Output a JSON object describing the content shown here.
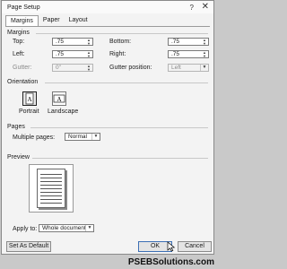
{
  "window": {
    "title": "Page Setup",
    "help_glyph": "?",
    "close_glyph": "✕"
  },
  "tabs": [
    {
      "label": "Margins",
      "active": true
    },
    {
      "label": "Paper",
      "active": false
    },
    {
      "label": "Layout",
      "active": false
    }
  ],
  "margins": {
    "heading": "Margins",
    "top_label": "Top:",
    "top_value": ".75",
    "bottom_label": "Bottom:",
    "bottom_value": ".75",
    "left_label": "Left:",
    "left_value": ".75",
    "right_label": "Right:",
    "right_value": ".75",
    "gutter_label": "Gutter:",
    "gutter_value": "0\"",
    "gutter_position_label": "Gutter position:",
    "gutter_position_value": "Left"
  },
  "orientation": {
    "heading": "Orientation",
    "portrait_label": "Portrait",
    "landscape_label": "Landscape",
    "icon_glyph": "A"
  },
  "pages": {
    "heading": "Pages",
    "multiple_pages_label": "Multiple pages:",
    "multiple_pages_value": "Normal"
  },
  "preview": {
    "heading": "Preview"
  },
  "apply_to": {
    "label": "Apply to:",
    "value": "Whole document"
  },
  "buttons": {
    "set_default": "Set As Default",
    "ok": "OK",
    "cancel": "Cancel"
  },
  "watermark": "PSEBSolutions.com",
  "colors": {
    "accent_border": "#3c6fb4",
    "dialog_bg": "#f3f3f3"
  },
  "icons": [
    "help-icon",
    "close-icon",
    "portrait-orientation-icon",
    "landscape-orientation-icon",
    "chevron-down-icon",
    "spin-arrows-icon",
    "mouse-pointer-icon"
  ]
}
